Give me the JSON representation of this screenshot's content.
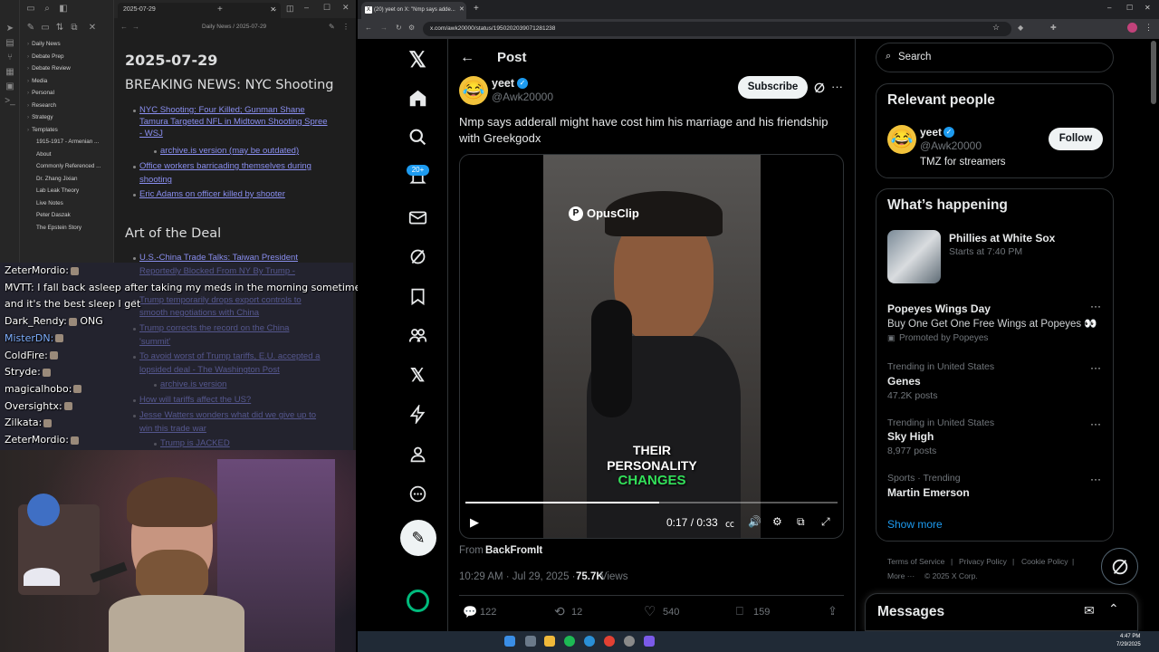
{
  "obsidian": {
    "note_tab_title": "2025-07-29",
    "breadcrumb": "Daily News / 2025-07-29",
    "folders": [
      "Daily News",
      "Debate Prep",
      "Debate Review",
      "Media",
      "Personal",
      "Research",
      "Strategy",
      "Templates"
    ],
    "files": [
      "1915-1917 - Armenian ...",
      "About",
      "Commonly Referenced ...",
      "Dr. Zhang Jixian",
      "Lab Leak Theory",
      "Live Notes",
      "Peter Daszak",
      "The Epstein Story"
    ],
    "note_title": "2025-07-29",
    "h1": "BREAKING NEWS: NYC Shooting",
    "links1": [
      "NYC Shooting: Four Killed; Gunman Shane",
      "Tamura Targeted NFL in Midtown Shooting Spree",
      "- WSJ",
      "archive.is version (may be outdated)",
      "Office workers barricading themselves during",
      "shooting",
      "Eric Adams on officer killed by shooter"
    ],
    "h2": "Art of the Deal",
    "links2": [
      "U.S.-China Trade Talks: Taiwan President",
      "Reportedly Blocked From NY By Trump -",
      "Trump temporarily drops export controls to",
      "smooth negotiations with China",
      "Trump corrects the record on the China",
      "'summit'",
      "To avoid worst of Trump tariffs, E.U. accepted a",
      "lopsided deal - The Washington Post",
      "archive.is version",
      "How will tariffs affect the US?",
      "Jesse Watters wonders what did we give up to",
      "win this trade war",
      "Trump is JACKED"
    ]
  },
  "chat": [
    {
      "user": "ZeterMordio:",
      "text": ""
    },
    {
      "user": "MVTT:",
      "text": "I fall back asleep after taking my meds in the morning sometimes"
    },
    {
      "user": "",
      "text": "and it's the best sleep I get"
    },
    {
      "user": "Dark_Rendy:",
      "text": "ONG"
    },
    {
      "user": "MisterDN:",
      "text": ""
    },
    {
      "user": "ColdFire:",
      "text": ""
    },
    {
      "user": "Stryde:",
      "text": ""
    },
    {
      "user": "magicalhobo:",
      "text": ""
    },
    {
      "user": "Oversightx:",
      "text": ""
    },
    {
      "user": "Zilkata:",
      "text": ""
    },
    {
      "user": "ZeterMordio:",
      "text": ""
    }
  ],
  "browser": {
    "tab_title": "(20) yeet on X: \"Nmp says adde...",
    "url": "x.com/awk20000/status/1950202039071281238"
  },
  "x": {
    "notif_badge": "20+",
    "header": "Post",
    "author_name": "yeet",
    "author_handle": "@Awk20000",
    "subscribe": "Subscribe",
    "tweet_text_1": "Nmp says adderall might have cost him his marriage and his friendship",
    "tweet_text_2": "with Greekgodx",
    "video_brand": "OpusClip",
    "caption_1": "THEIR",
    "caption_2": "PERSONALITY",
    "caption_3": "CHANGES",
    "video_time": "0:17 / 0:33",
    "video_progress": 0.52,
    "from_label": "From ",
    "from_source": "BackFromIt",
    "timestamp": "10:29 AM · Jul 29, 2025 · ",
    "views": "75.7K",
    "views_label": " Views",
    "replies": "122",
    "reposts": "12",
    "likes": "540",
    "bookmarks": "159",
    "search_placeholder": "Search",
    "relevant_title": "Relevant people",
    "rel_name": "yeet",
    "rel_handle": "@Awk20000",
    "rel_bio": "TMZ for streamers",
    "follow": "Follow",
    "happening_title": "What’s happening",
    "trends": [
      {
        "meta": "Starts at 7:40 PM",
        "title": "Phillies at White Sox"
      },
      {
        "meta": "Promoted by Popeyes",
        "title": "Popeyes Wings Day",
        "sub": "Buy One Get One Free Wings at Popeyes 👀"
      },
      {
        "meta": "Trending in United States",
        "title": "Genes",
        "sub": "47.2K posts"
      },
      {
        "meta": "Trending in United States",
        "title": "Sky High",
        "sub": "8,977 posts"
      },
      {
        "meta": "Sports · Trending",
        "title": "Martin Emerson"
      }
    ],
    "show_more": "Show more",
    "footer": [
      "Terms of Service",
      "Privacy Policy",
      "Cookie Policy",
      "More ···",
      "© 2025 X Corp."
    ],
    "messages": "Messages"
  },
  "taskbar": {
    "time": "4:47 PM",
    "date": "7/29/2025"
  }
}
